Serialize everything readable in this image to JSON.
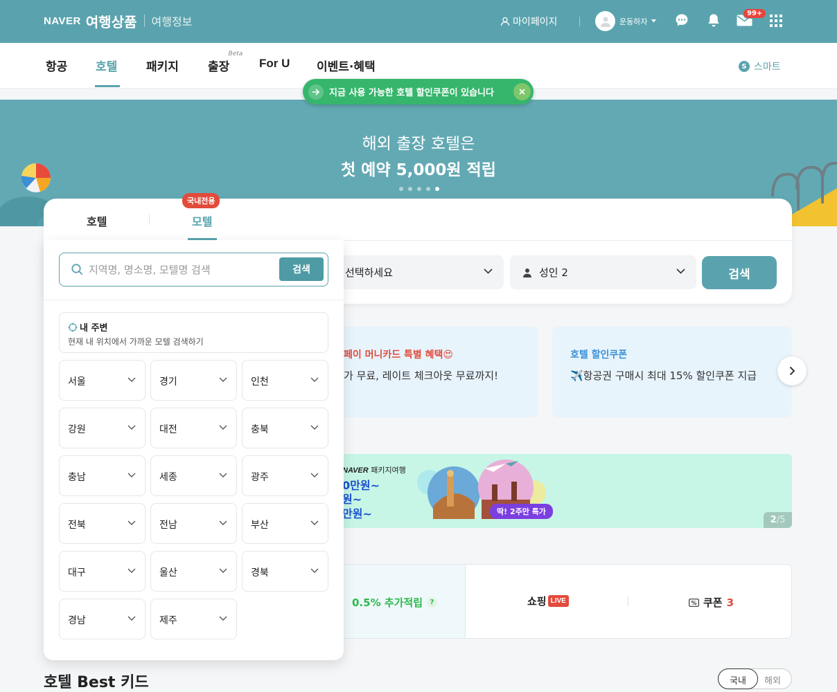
{
  "header": {
    "logo_brand": "NAVER",
    "logo_product": "여행상품",
    "logo_info": "여행정보",
    "mypage_label": "마이페이지",
    "username": "운동하자",
    "mail_badge": "99+"
  },
  "nav": {
    "tabs": [
      {
        "label": "항공"
      },
      {
        "label": "호텔"
      },
      {
        "label": "패키지"
      },
      {
        "label": "출장"
      },
      {
        "label": "For U"
      },
      {
        "label": "이벤트·혜택"
      }
    ],
    "beta_label": "Beta",
    "smart_letter": "S",
    "smart_label": "스마트"
  },
  "coupon_notice": "지금 사용 가능한 호텔 할인쿠폰이 있습니다",
  "banner": {
    "line1": "해외 출장 호텔은",
    "line2": "첫 예약 5,000원 적립",
    "slide_count": 5,
    "active_slide": 5
  },
  "search_card": {
    "tab_hotel": "호텔",
    "tab_motel": "모텔",
    "domestic_badge": "국내전용",
    "date_placeholder": "선택하세요",
    "guests": "성인 2",
    "search_button": "검색"
  },
  "dropdown": {
    "search_placeholder": "지역명, 명소명, 모텔명 검색",
    "search_button": "검색",
    "nearby_title": "내 주변",
    "nearby_subtitle": "현재 내 위치에서 가까운 모텔 검색하기",
    "regions": [
      "서울",
      "경기",
      "인천",
      "강원",
      "대전",
      "충북",
      "충남",
      "세종",
      "광주",
      "전북",
      "전남",
      "부산",
      "대구",
      "울산",
      "경북",
      "경남",
      "제주"
    ]
  },
  "promos": {
    "card1_title": "페이 머니카드 특별 혜택😍",
    "card1_desc": "가 무료, 레이트 체크아웃 무료까지!",
    "card2_title": "호텔 할인쿠폰",
    "card2_desc": "✈️항공권 구매시 최대 15% 할인쿠폰 지급"
  },
  "package_banner": {
    "brand": "NAVER",
    "brand_suffix": " 패키지여행",
    "line1": "0만원~",
    "line2": "원~",
    "line3": "만원~",
    "badge": "딱! 2주만 특가",
    "counter_current": "2",
    "counter_total": "/5"
  },
  "benefits": {
    "points": "0.5% 추가적립",
    "help": "?",
    "shopping": "쇼핑",
    "live": "LIVE",
    "coupon_label": "쿠폰",
    "coupon_count": "3"
  },
  "bottom": {
    "title": "호텔 Best 키드",
    "toggle_on": "국내",
    "toggle_off": "해외"
  },
  "colors": {
    "brand_teal": "#5aa3ae",
    "notice_green": "#36b66c",
    "alert_red": "#e24b3b",
    "package_bg": "#c7f6e6",
    "promo_bg": "#e8f4fc"
  }
}
